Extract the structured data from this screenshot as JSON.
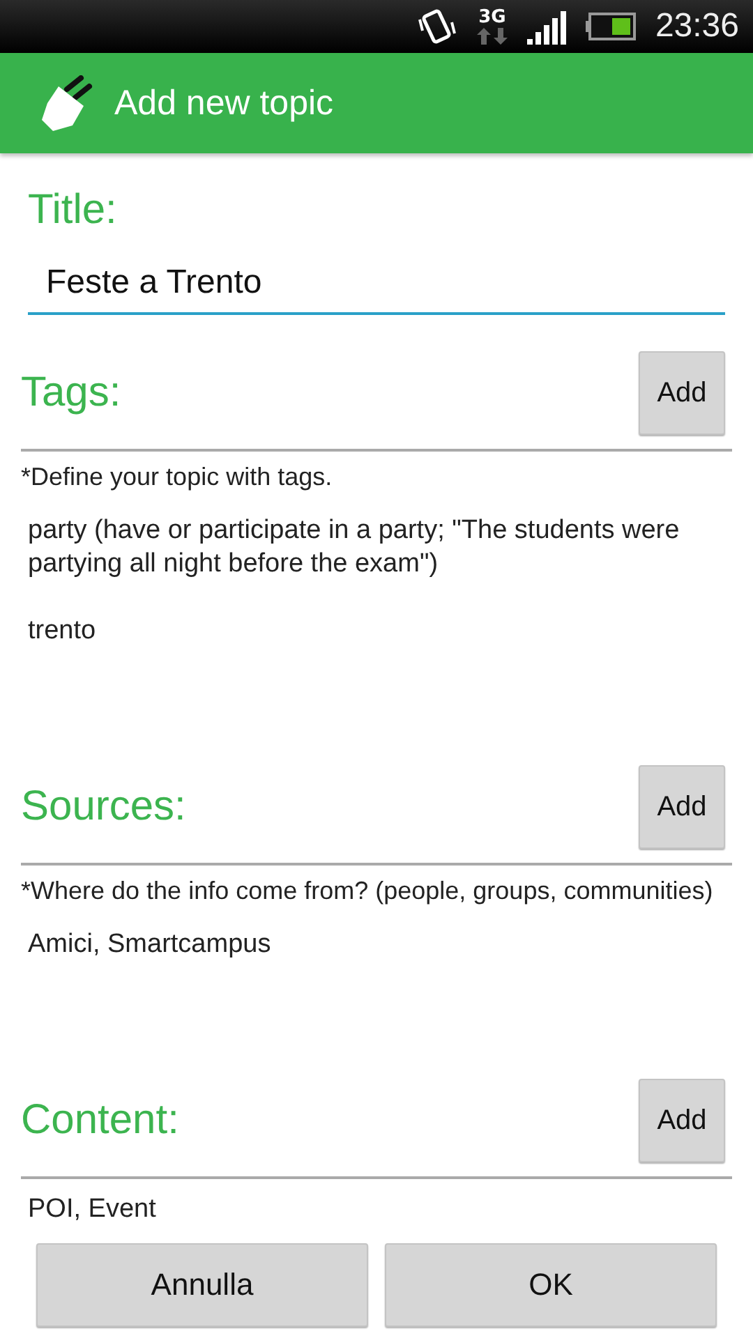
{
  "status_bar": {
    "network": "3G",
    "time": "23:36"
  },
  "app_bar": {
    "title": "Add new topic"
  },
  "title_field": {
    "label": "Title:",
    "value": "Feste a Trento"
  },
  "sections": [
    {
      "heading": "Tags:",
      "button": "Add",
      "hint": "*Define your topic with tags.",
      "items": [
        "party (have or participate in a party; \"The students were partying all night before the exam\")",
        "trento"
      ]
    },
    {
      "heading": "Sources:",
      "button": "Add",
      "hint": "*Where do the info come from? (people, groups, communities)",
      "items": [
        "Amici, Smartcampus"
      ]
    },
    {
      "heading": "Content:",
      "button": "Add",
      "items": [
        "POI, Event"
      ]
    }
  ],
  "buttons": [
    "Annulla",
    "OK"
  ]
}
